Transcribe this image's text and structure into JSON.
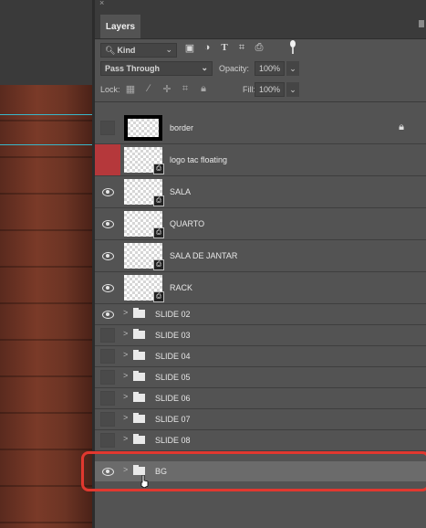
{
  "panel": {
    "close_glyph": "×",
    "tab_label": "Layers"
  },
  "filter": {
    "kind_label": "Kind",
    "kind_icon": "search-icon",
    "filter_icons": [
      "image-filter-icon",
      "adjustment-filter-icon",
      "type-filter-icon",
      "shape-filter-icon",
      "smart-object-filter-icon"
    ]
  },
  "blend": {
    "mode": "Pass Through",
    "opacity_label": "Opacity:",
    "opacity_value": "100%"
  },
  "lock": {
    "label": "Lock:",
    "fill_label": "Fill:",
    "fill_value": "100%"
  },
  "layers": [
    {
      "name": "border",
      "visible": false,
      "locked": true
    },
    {
      "name": "logo tac floating",
      "visible": false,
      "highlighted_eye": true
    },
    {
      "name": "SALA",
      "visible": true
    },
    {
      "name": "QUARTO",
      "visible": true
    },
    {
      "name": "SALA DE JANTAR",
      "visible": true
    },
    {
      "name": "RACK",
      "visible": true
    }
  ],
  "groups": [
    {
      "name": "SLIDE 02",
      "visible": true
    },
    {
      "name": "SLIDE 03",
      "visible": false
    },
    {
      "name": "SLIDE 04",
      "visible": false
    },
    {
      "name": "SLIDE 05",
      "visible": false
    },
    {
      "name": "SLIDE 06",
      "visible": false
    },
    {
      "name": "SLIDE 07",
      "visible": false
    },
    {
      "name": "SLIDE 08",
      "visible": false
    }
  ],
  "bg_group": {
    "name": "BG",
    "visible": true,
    "selected": true
  },
  "colors": {
    "panel_bg": "#535353",
    "highlight_red": "#e2382f",
    "eye_red": "#b5383b",
    "guide_cyan": "#39b7c9"
  }
}
